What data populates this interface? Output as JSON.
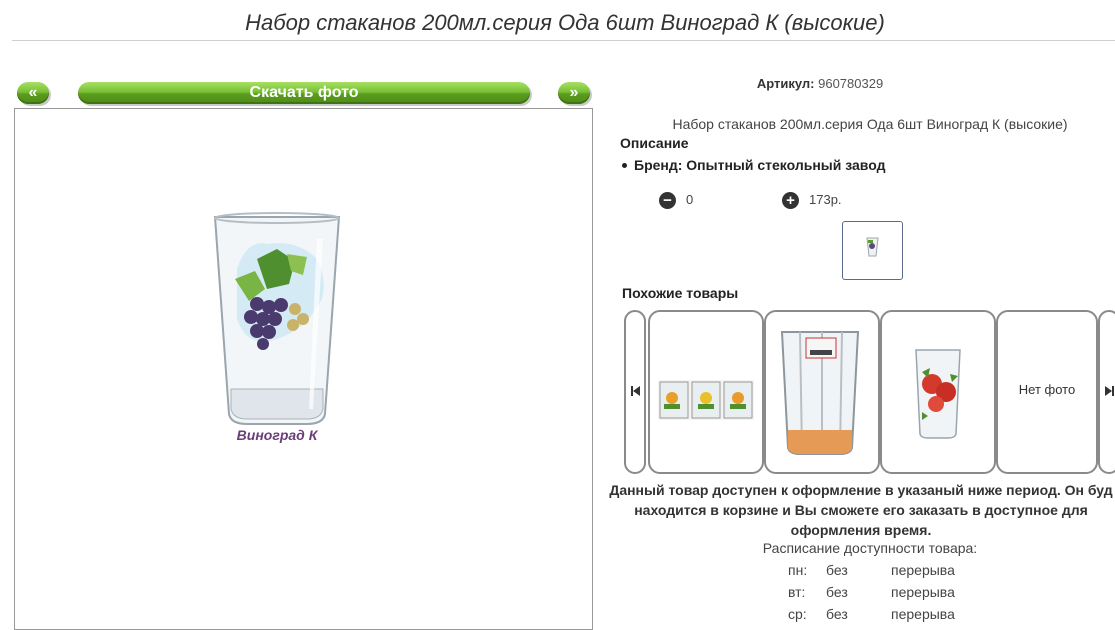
{
  "title": "Набор стаканов 200мл.серия Ода 6шт Виноград К (высокие)",
  "gallery": {
    "prev_label": "«",
    "download_label": "Скачать фото",
    "next_label": "»",
    "photo_caption": "Виноград К"
  },
  "product": {
    "article_label": "Артикул:",
    "article_value": "960780329",
    "name_line": "Набор стаканов 200мл.серия Ода 6шт Виноград К (высокие)",
    "description_heading": "Описание",
    "brand_text": "Бренд: Опытный стекольный завод",
    "quantity": "0",
    "price": "173р.",
    "minus_symbol": "−",
    "plus_symbol": "+"
  },
  "similar": {
    "heading": "Похожие товары",
    "no_photo_label": "Нет фото"
  },
  "availability": {
    "notice": "Данный товар доступен к оформление в указаный ниже период. Он буд находится в корзине и Вы сможете его заказать в доступное для оформления время.",
    "schedule_title": "Расписание доступности товара:",
    "rows": [
      {
        "day": "пн:",
        "a": "без",
        "b": "перерыва"
      },
      {
        "day": "вт:",
        "a": "без",
        "b": "перерыва"
      },
      {
        "day": "ср:",
        "a": "без",
        "b": "перерыва"
      }
    ]
  },
  "colors": {
    "button_green": "#78c035",
    "frame_border": "#999999",
    "text_dark": "#333333"
  }
}
